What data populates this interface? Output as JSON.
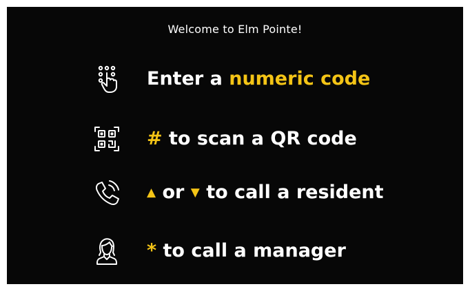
{
  "welcome": "Welcome to Elm Pointe!",
  "colors": {
    "background": "#070707",
    "text": "#ffffff",
    "accent": "#f4c416"
  },
  "options": [
    {
      "icon": "keypad-touch-icon",
      "lead": "Enter a ",
      "accent": "numeric code"
    },
    {
      "icon": "qr-code-icon",
      "key": "#",
      "text": " to scan a QR code"
    },
    {
      "icon": "phone-call-icon",
      "up_key": "▲",
      "middle": " or ",
      "down_key": "▼",
      "text": " to call a resident"
    },
    {
      "icon": "manager-icon",
      "key": "*",
      "text": " to call a manager"
    }
  ]
}
